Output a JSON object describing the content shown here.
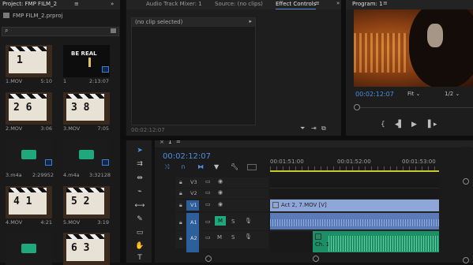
{
  "project": {
    "title": "Project: FMP FILM_2",
    "filename": "FMP FILM_2.prproj",
    "clips": [
      {
        "name": "1.MOV",
        "duration": "5:10",
        "slate": "1",
        "type": "video"
      },
      {
        "name": "1",
        "duration": "2:13:07",
        "slate": "",
        "type": "video-title"
      },
      {
        "name": "2.MOV",
        "duration": "3:06",
        "slate": "2 6",
        "type": "video"
      },
      {
        "name": "3.MOV",
        "duration": "7:05",
        "slate": "3 8",
        "type": "video"
      },
      {
        "name": "3.m4a",
        "duration": "2:29952",
        "type": "audio"
      },
      {
        "name": "4.m4a",
        "duration": "3:32128",
        "type": "audio"
      },
      {
        "name": "4.MOV",
        "duration": "4:21",
        "slate": "4 1",
        "type": "video"
      },
      {
        "name": "5.MOV",
        "duration": "3:19",
        "slate": "5 2",
        "type": "video"
      },
      {
        "name": "",
        "duration": "",
        "type": "audio"
      },
      {
        "name": "",
        "duration": "",
        "slate": "6 3",
        "type": "video"
      }
    ],
    "title_clip_text": "BE REAL"
  },
  "source_panel": {
    "tabs": [
      "Audio Track Mixer: 1",
      "Source: (no clips)",
      "Effect Controls"
    ],
    "active_tab": "Effect Controls",
    "no_clip": "(no clip selected)",
    "timecode": "00:02:12:07"
  },
  "program": {
    "title": "Program: 1",
    "timecode": "00:02:12:07",
    "fit": "Fit",
    "resolution": "1/2"
  },
  "timeline": {
    "sequence_tab": "1",
    "timecode": "00:02:12:07",
    "ruler": [
      "00:01:51:00",
      "00:01:52:00",
      "00:01:53:00"
    ],
    "tracks": [
      {
        "id": "V3",
        "kind": "video"
      },
      {
        "id": "V2",
        "kind": "video"
      },
      {
        "id": "V1",
        "kind": "video",
        "target": "V1"
      },
      {
        "id": "A1",
        "kind": "audio",
        "target": "A1",
        "m": "M",
        "s": "S"
      },
      {
        "id": "A2",
        "kind": "audio",
        "m": "M",
        "s": "S"
      }
    ],
    "clips": {
      "video_clip": "Act 2, 7.MOV [V]",
      "audio_clip": "Ch. 1"
    }
  },
  "colors": {
    "accent_blue": "#4a8fe0",
    "audio_green": "#1ea87b",
    "video_clip": "#8fa7d8",
    "audio_clip": "#5b7ab8"
  }
}
